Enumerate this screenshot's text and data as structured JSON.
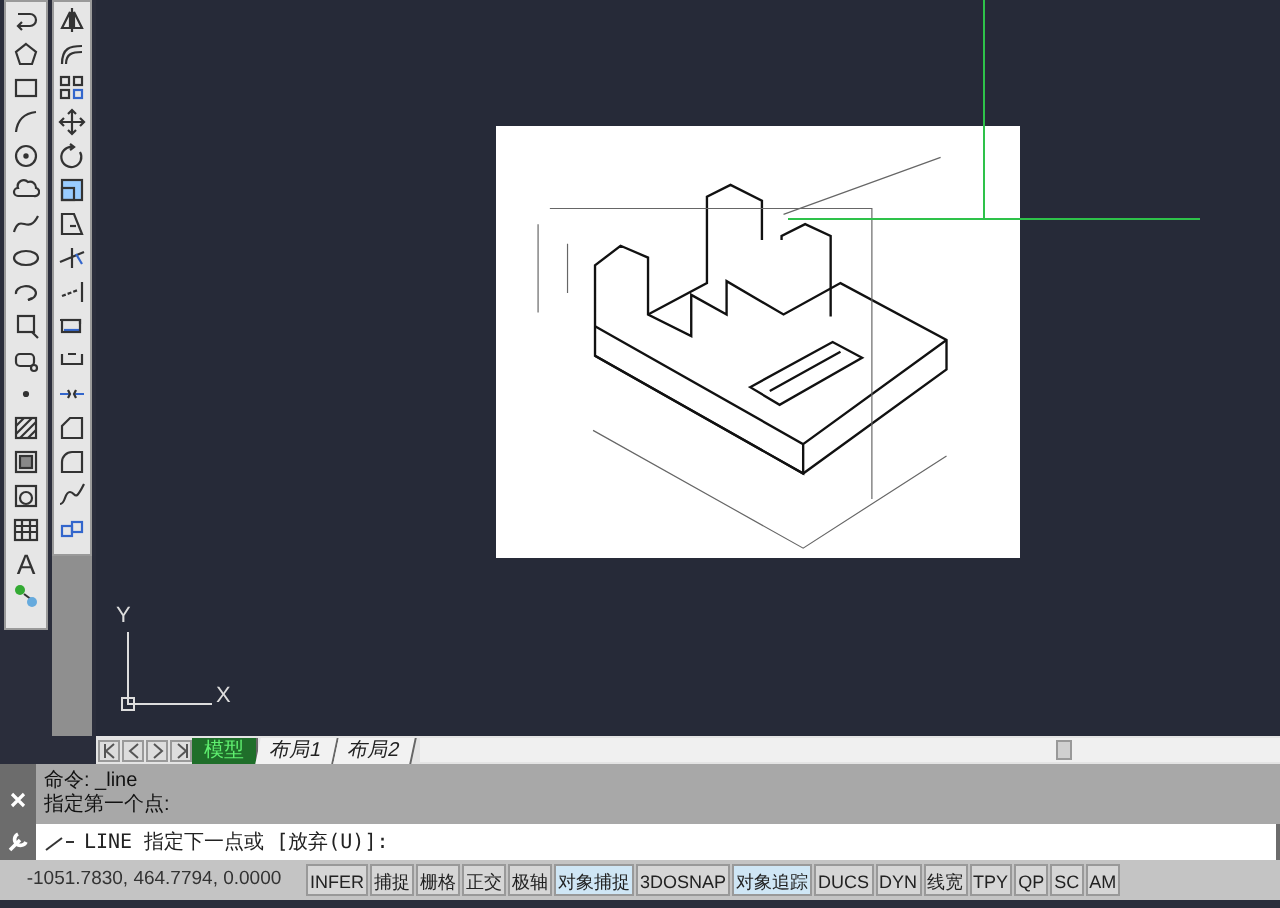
{
  "toolbar_text_tool": "A",
  "ucs": {
    "y_label": "Y",
    "x_label": "X"
  },
  "layout_tabs": [
    {
      "label": "模型",
      "selected": true
    },
    {
      "label": "布局1",
      "selected": false
    },
    {
      "label": "布局2",
      "selected": false
    }
  ],
  "command_history": [
    "命令: _line",
    "指定第一个点:"
  ],
  "command_input": {
    "value": "LINE 指定下一点或 [放弃(U)]:"
  },
  "status_bar": {
    "coordinates": "-1051.7830, 464.7794, 0.0000",
    "toggles": [
      {
        "label": "INFER",
        "on": false
      },
      {
        "label": "捕捉",
        "on": false
      },
      {
        "label": "栅格",
        "on": false
      },
      {
        "label": "正交",
        "on": false
      },
      {
        "label": "极轴",
        "on": false
      },
      {
        "label": "对象捕捉",
        "on": true
      },
      {
        "label": "3DOSNAP",
        "on": false
      },
      {
        "label": "对象追踪",
        "on": true
      },
      {
        "label": "DUCS",
        "on": false
      },
      {
        "label": "DYN",
        "on": false
      },
      {
        "label": "线宽",
        "on": false
      },
      {
        "label": "TPY",
        "on": false
      },
      {
        "label": "QP",
        "on": false
      },
      {
        "label": "SC",
        "on": false
      },
      {
        "label": "AM",
        "on": false
      }
    ]
  }
}
